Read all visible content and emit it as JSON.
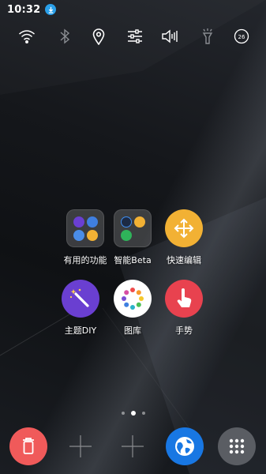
{
  "status_bar": {
    "time": "10:32",
    "notification_icon": "download-icon"
  },
  "quick_toggles": [
    {
      "name": "wifi-icon"
    },
    {
      "name": "bluetooth-icon"
    },
    {
      "name": "location-icon"
    },
    {
      "name": "settings-sliders-icon"
    },
    {
      "name": "sound-icon"
    },
    {
      "name": "flashlight-icon"
    },
    {
      "name": "auto-brightness-icon",
      "label": "26"
    }
  ],
  "apps": [
    {
      "label": "有用的功能",
      "icon": "folder-icon"
    },
    {
      "label": "智能Beta",
      "icon": "folder-icon"
    },
    {
      "label": "快速编辑",
      "icon": "move-arrows-icon",
      "color": "#f2b134"
    },
    {
      "label": "主题DIY",
      "icon": "magic-wand-icon",
      "color": "#6a3fd1"
    },
    {
      "label": "图库",
      "icon": "gallery-flower-icon",
      "color": "#ffffff"
    },
    {
      "label": "手势",
      "icon": "gesture-hand-icon",
      "color": "#e8424f"
    }
  ],
  "pager": {
    "pages": 3,
    "active": 2
  },
  "dock": [
    {
      "name": "recycle-bin-icon",
      "color": "#f05a5a"
    },
    {
      "name": "add-slot-icon"
    },
    {
      "name": "add-slot-icon"
    },
    {
      "name": "browser-globe-icon",
      "color": "#1877e3"
    },
    {
      "name": "app-drawer-icon",
      "color": "#5a5d63"
    }
  ]
}
